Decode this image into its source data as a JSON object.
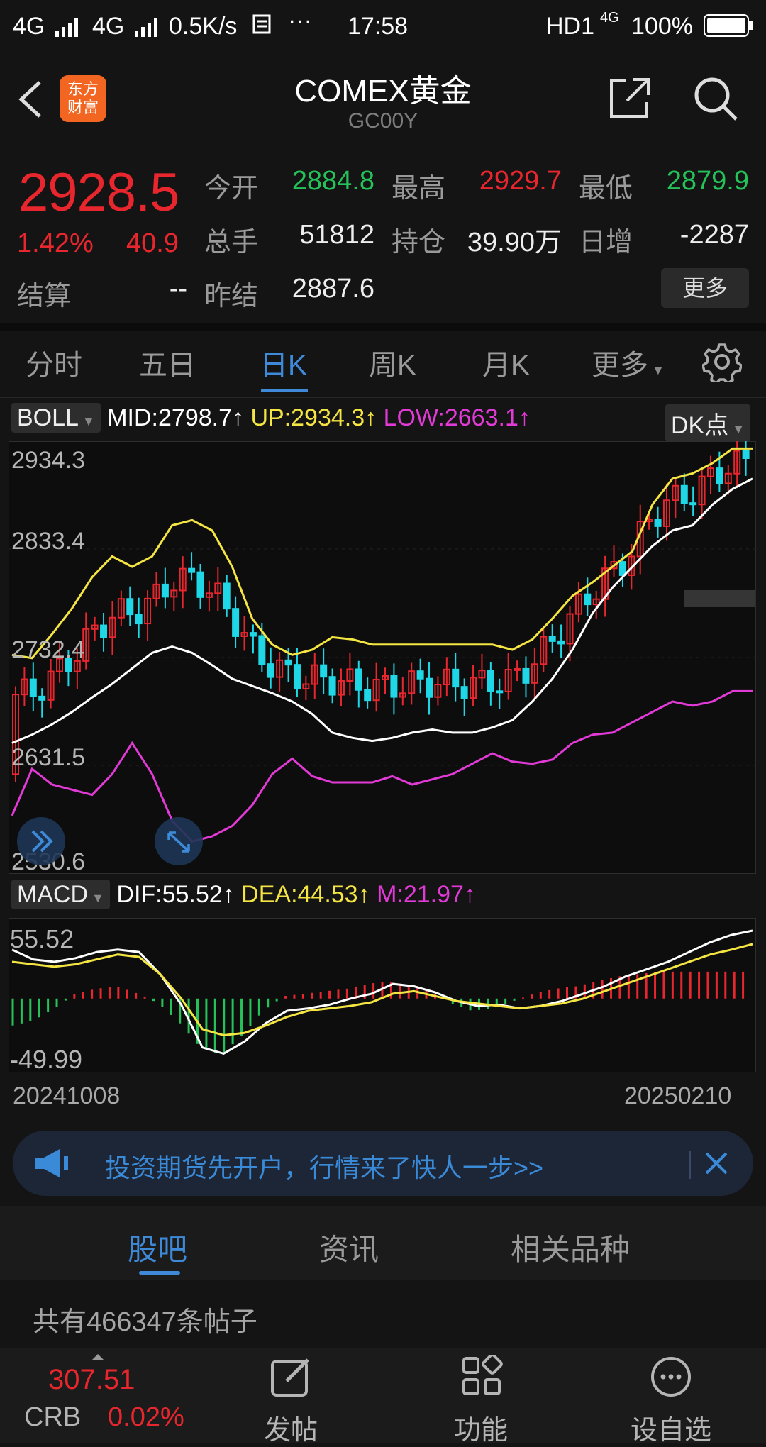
{
  "status_bar": {
    "network_1": "4G",
    "network_2": "4G",
    "speed": "0.5K/s",
    "time": "17:58",
    "hd": "HD1",
    "battery": "100%"
  },
  "header": {
    "logo_text_1": "东方",
    "logo_text_2": "财富",
    "title": "COMEX黄金",
    "subtitle": "GC00Y"
  },
  "quote": {
    "price": "2928.5",
    "change_pct": "1.42%",
    "change": "40.9",
    "open_label": "今开",
    "open": "2884.8",
    "high_label": "最高",
    "high": "2929.7",
    "low_label": "最低",
    "low": "2879.9",
    "volume_label": "总手",
    "volume": "51812",
    "oi_label": "持仓",
    "oi": "39.90万",
    "daily_inc_label": "日增",
    "daily_inc": "-2287",
    "settle_label": "结算",
    "settle": "--",
    "prev_settle_label": "昨结",
    "prev_settle": "2887.6",
    "more_label": "更多"
  },
  "period_tabs": [
    "分时",
    "五日",
    "日K",
    "周K",
    "月K",
    "更多"
  ],
  "boll": {
    "name": "BOLL",
    "mid": "MID:2798.7↑",
    "up": "UP:2934.3↑",
    "low": "LOW:2663.1↑",
    "dk_label": "DK点",
    "axis_labels": [
      "2934.3",
      "2833.4",
      "2732.4",
      "2631.5",
      "2530.6"
    ]
  },
  "macd": {
    "name": "MACD",
    "dif": "DIF:55.52↑",
    "dea": "DEA:44.53↑",
    "m": "M:21.97↑",
    "axis_top": "55.52",
    "axis_bottom": "-49.99"
  },
  "dates": {
    "start": "20241008",
    "end": "20250210"
  },
  "banner": {
    "text": "投资期货先开户，行情来了快人一步>>"
  },
  "content_tabs": [
    "股吧",
    "资讯",
    "相关品种"
  ],
  "posts": {
    "text": "共有466347条帖子"
  },
  "bottom_nav": {
    "crb_value": "307.51",
    "crb_label": "CRB",
    "crb_change": "0.02%",
    "post_label": "发帖",
    "function_label": "功能",
    "watchlist_label": "设自选"
  },
  "colors": {
    "up": "#e8262d",
    "down": "#1fd7e6",
    "accent": "#3e8ad8",
    "mid_line": "#ffffff",
    "upper_band": "#f4e543",
    "lower_band": "#e23ad6"
  },
  "chart_data": [
    {
      "type": "candlestick",
      "title": "",
      "ylim": [
        2530.6,
        2934.3
      ],
      "x_range": [
        "20241008",
        "20250210"
      ],
      "series": [
        {
          "name": "MID",
          "values": [
            2650,
            2658,
            2668,
            2680,
            2694,
            2707,
            2722,
            2737,
            2743,
            2737,
            2725,
            2712,
            2705,
            2698,
            2690,
            2678,
            2660,
            2655,
            2652,
            2655,
            2660,
            2663,
            2660,
            2660,
            2665,
            2672,
            2690,
            2712,
            2740,
            2775,
            2800,
            2820,
            2840,
            2855,
            2860,
            2880,
            2895,
            2905
          ]
        },
        {
          "name": "UP",
          "values": [
            2735,
            2732,
            2755,
            2780,
            2810,
            2830,
            2820,
            2830,
            2860,
            2865,
            2855,
            2820,
            2770,
            2745,
            2735,
            2740,
            2752,
            2750,
            2745,
            2745,
            2745,
            2745,
            2745,
            2745,
            2745,
            2740,
            2750,
            2770,
            2792,
            2805,
            2820,
            2835,
            2880,
            2905,
            2910,
            2920,
            2934,
            2934
          ]
        },
        {
          "name": "LOW",
          "values": [
            2580,
            2625,
            2610,
            2605,
            2600,
            2620,
            2650,
            2620,
            2575,
            2555,
            2560,
            2570,
            2590,
            2620,
            2635,
            2618,
            2612,
            2612,
            2612,
            2618,
            2610,
            2615,
            2620,
            2630,
            2640,
            2632,
            2630,
            2634,
            2650,
            2658,
            2660,
            2670,
            2680,
            2690,
            2686,
            2690,
            2700,
            2700
          ]
        }
      ]
    },
    {
      "type": "bar",
      "title": "",
      "ylim": [
        -49.99,
        55.52
      ],
      "series": [
        {
          "name": "DIF",
          "values": [
            40,
            32,
            30,
            33,
            38,
            40,
            38,
            20,
            -5,
            -40,
            -45,
            -35,
            -20,
            -10,
            -8,
            -5,
            0,
            4,
            12,
            10,
            5,
            -2,
            -6,
            -5,
            -8,
            -6,
            -2,
            4,
            10,
            18,
            24,
            30,
            38,
            46,
            52,
            55.52
          ]
        },
        {
          "name": "DEA",
          "values": [
            30,
            28,
            26,
            28,
            32,
            36,
            34,
            20,
            0,
            -25,
            -30,
            -28,
            -22,
            -15,
            -10,
            -8,
            -6,
            -3,
            4,
            6,
            2,
            -2,
            -4,
            -6,
            -8,
            -6,
            -4,
            0,
            6,
            12,
            18,
            24,
            30,
            36,
            40,
            44.53
          ]
        },
        {
          "name": "M",
          "values": [
            -22,
            -18,
            -8,
            4,
            8,
            10,
            4,
            -4,
            -20,
            -40,
            -46,
            -30,
            -10,
            2,
            4,
            6,
            8,
            12,
            14,
            10,
            6,
            -4,
            -10,
            -8,
            -2,
            4,
            8,
            10,
            14,
            18,
            20,
            22,
            22,
            22,
            22,
            21.97
          ]
        }
      ]
    }
  ]
}
